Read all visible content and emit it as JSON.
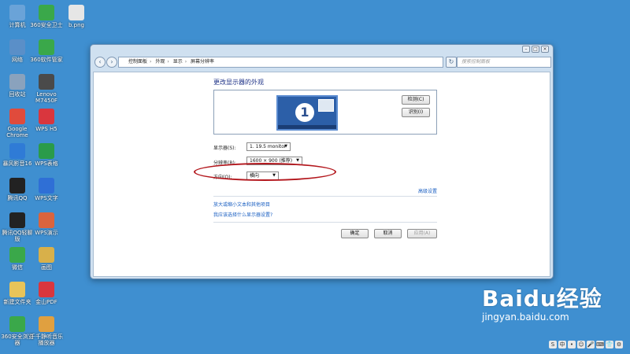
{
  "desktop_icons": [
    {
      "label": "计算机",
      "icon": "computer-icon",
      "color": "#6aa3d8"
    },
    {
      "label": "360安全卫士",
      "icon": "360-safe-icon",
      "color": "#3aa84a"
    },
    {
      "label": "b.png",
      "icon": "image-file-icon",
      "color": "#e6e6e6"
    },
    {
      "label": "网络",
      "icon": "network-icon",
      "color": "#5a8fc8"
    },
    {
      "label": "360软件管家",
      "icon": "360-software-icon",
      "color": "#3aa84a"
    },
    {
      "label": "回收站",
      "icon": "recycle-bin-icon",
      "color": "#8aa2bd"
    },
    {
      "label": "Lenovo M7450F",
      "icon": "printer-icon",
      "color": "#4a4a4a"
    },
    {
      "label": "Google Chrome",
      "icon": "chrome-icon",
      "color": "#e04b3c"
    },
    {
      "label": "WPS H5",
      "icon": "wps-h5-icon",
      "color": "#d9363e"
    },
    {
      "label": "暴风影音16",
      "icon": "video-player-icon",
      "color": "#2f7bd6"
    },
    {
      "label": "WPS表格",
      "icon": "wps-sheet-icon",
      "color": "#2a9b4a"
    },
    {
      "label": "腾讯QQ",
      "icon": "qq-icon",
      "color": "#222222"
    },
    {
      "label": "WPS文字",
      "icon": "wps-writer-icon",
      "color": "#2f6fd6"
    },
    {
      "label": "腾讯QQ轻聊版",
      "icon": "qq-lite-icon",
      "color": "#222222"
    },
    {
      "label": "WPS演示",
      "icon": "wps-ppt-icon",
      "color": "#d9643e"
    },
    {
      "label": "微信",
      "icon": "wechat-icon",
      "color": "#3aa84a"
    },
    {
      "label": "画图",
      "icon": "paint-icon",
      "color": "#d8b04a"
    },
    {
      "label": "新建文件夹",
      "icon": "folder-icon",
      "color": "#e8c45a"
    },
    {
      "label": "金山PDF",
      "icon": "pdf-icon",
      "color": "#d9363e"
    },
    {
      "label": "360安全浏览器",
      "icon": "360-browser-icon",
      "color": "#3aa84a"
    },
    {
      "label": "千千静听音乐播放器",
      "icon": "music-player-icon",
      "color": "#e0a040"
    }
  ],
  "window": {
    "address": [
      "控制面板",
      "外观",
      "显示",
      "屏幕分辨率"
    ],
    "search_placeholder": "搜索控制面板",
    "heading": "更改显示器的外观",
    "detect_button": "检测(C)",
    "identify_button": "识别(I)",
    "monitor_number": "1",
    "display_label": "显示器(S):",
    "display_value": "1. 19.5 monitor",
    "resolution_label": "分辨率(R):",
    "resolution_value": "1600 × 900 (推荐)",
    "orientation_label": "方向(O):",
    "orientation_value": "横向",
    "advanced_link": "高级设置",
    "link_text_size": "放大或缩小文本和其他项目",
    "link_which_settings": "我应该选择什么显示器设置?",
    "ok_button": "确定",
    "cancel_button": "取消",
    "apply_button": "应用(A)"
  },
  "watermark": {
    "logo": "Baidu经验",
    "url": "jingyan.baidu.com"
  },
  "tray": [
    "S",
    "中",
    "•",
    "☺",
    "🎤",
    "⌨",
    "👕",
    "⚙"
  ]
}
